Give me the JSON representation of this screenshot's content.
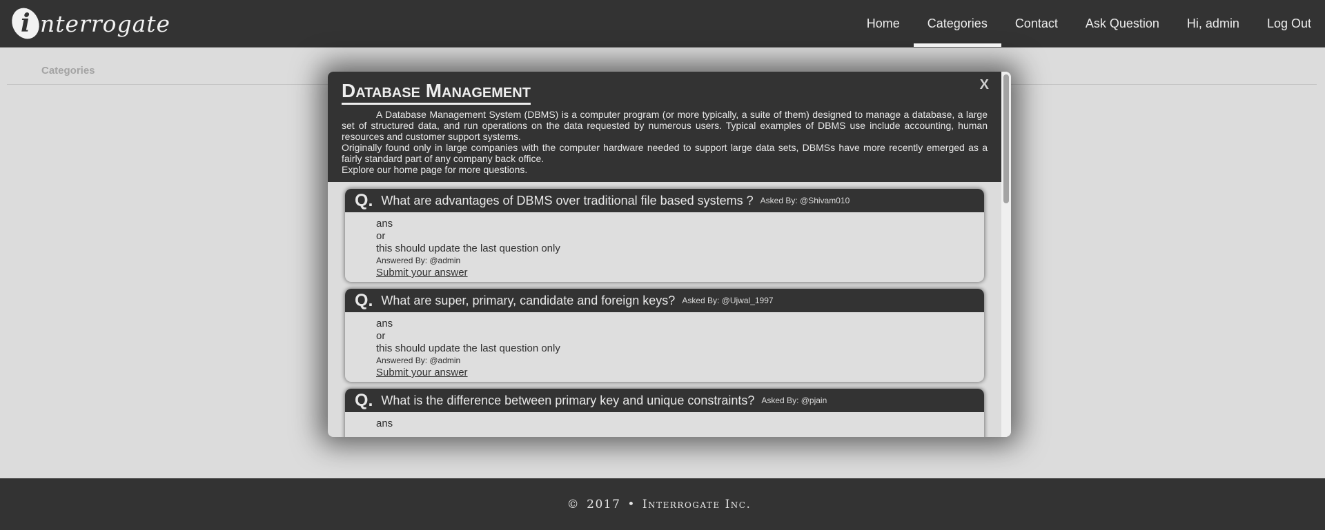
{
  "header": {
    "logo_letter": "i",
    "logo_text": "nterrogate",
    "nav": [
      {
        "label": "Home"
      },
      {
        "label": "Categories"
      },
      {
        "label": "Contact"
      },
      {
        "label": "Ask Question"
      },
      {
        "label": "Hi, admin"
      },
      {
        "label": "Log Out"
      }
    ],
    "active_nav": "Categories"
  },
  "breadcrumb": "Categories",
  "modal": {
    "close_label": "X",
    "title": "Database Management",
    "description": [
      "A Database Management System (DBMS) is a computer program (or more typically, a suite of them) designed to manage a database, a large set of structured data, and run operations on the data requested by numerous users. Typical examples of DBMS use include accounting, human resources and customer support systems.",
      "Originally found only in large companies with the computer hardware needed to support large data sets, DBMSs have more recently emerged as a fairly standard part of any company back office.",
      "Explore our home page for more questions."
    ],
    "questions": [
      {
        "q_mark": "Q.",
        "text": "What are advantages of DBMS over traditional file based systems ?",
        "asked_by": "Asked By: @Shivam010",
        "answer_lines": [
          "ans",
          "or",
          "this should update the last question only"
        ],
        "answered_by": "Answered By: @admin",
        "submit_label": "Submit your answer"
      },
      {
        "q_mark": "Q.",
        "text": "What are super, primary, candidate and foreign keys?",
        "asked_by": "Asked By: @Ujwal_1997",
        "answer_lines": [
          "ans",
          "or",
          "this should update the last question only"
        ],
        "answered_by": "Answered By: @admin",
        "submit_label": "Submit your answer"
      },
      {
        "q_mark": "Q.",
        "text": "What is the difference between primary key and unique constraints?",
        "asked_by": "Asked By: @pjain",
        "answer_lines": [
          "ans"
        ],
        "answered_by": "",
        "submit_label": ""
      }
    ]
  },
  "footer": {
    "copyright": "©",
    "year": "2017",
    "separator": "•",
    "company": "Interrogate Inc."
  },
  "colors": {
    "header_bg": "#333333",
    "page_bg": "#dcdcdc",
    "card_bg": "#dedede"
  }
}
